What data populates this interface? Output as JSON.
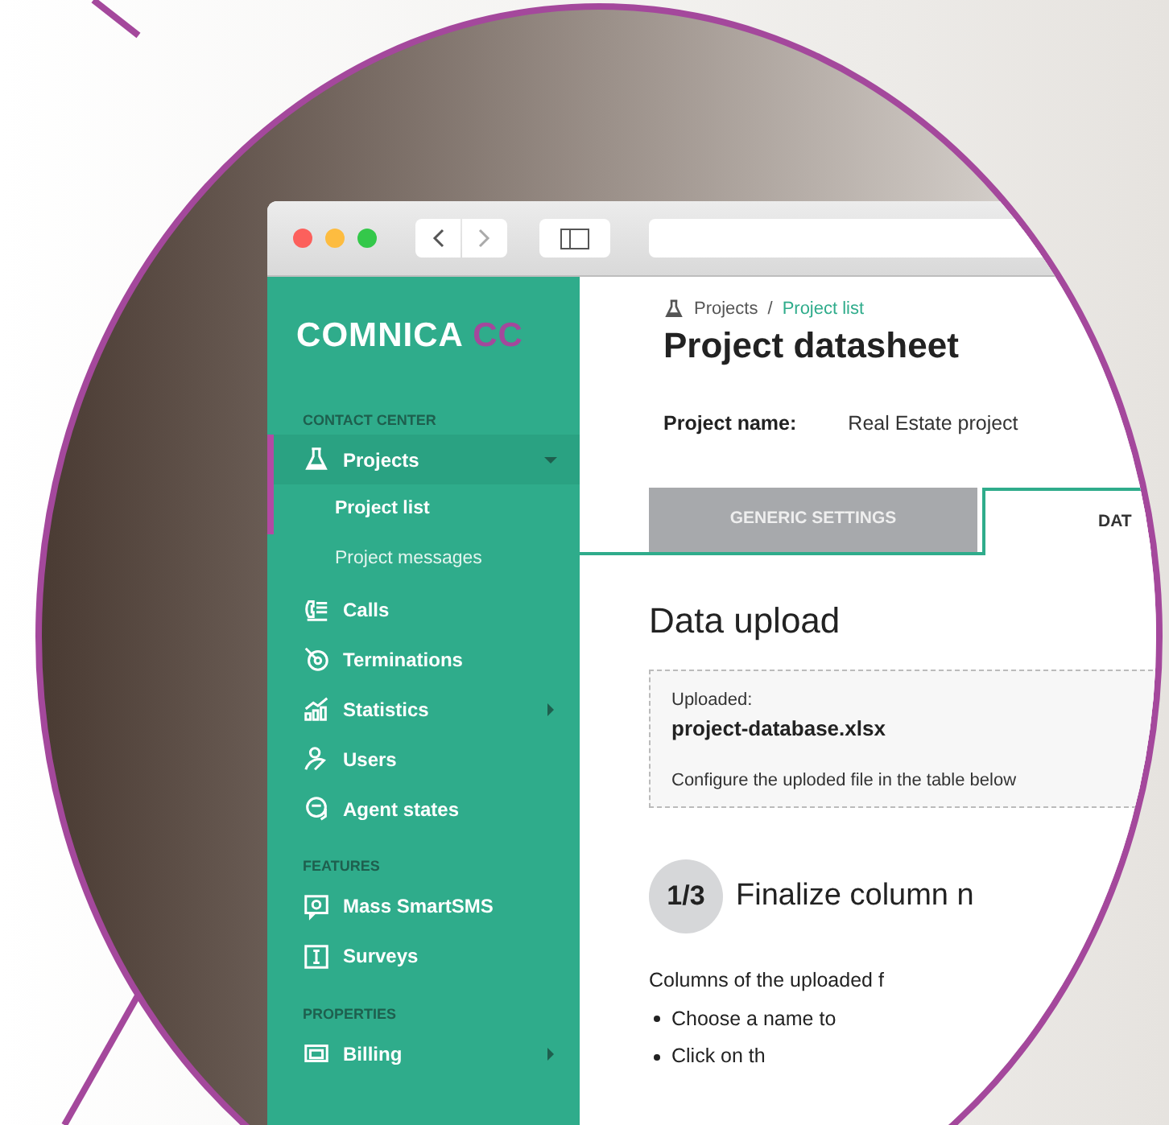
{
  "sidebar": {
    "logo": {
      "name": "COMNICA",
      "accent": "CC"
    },
    "sections": [
      {
        "heading": "CONTACT CENTER",
        "items": [
          {
            "label": "Projects",
            "selected": true,
            "has_submenu": true,
            "expanded": true,
            "children": [
              {
                "label": "Project list",
                "selected": true
              },
              {
                "label": "Project messages",
                "selected": false
              }
            ]
          },
          {
            "label": "Calls",
            "selected": false,
            "has_submenu": false
          },
          {
            "label": "Terminations",
            "selected": false,
            "has_submenu": false
          },
          {
            "label": "Statistics",
            "selected": false,
            "has_submenu": true,
            "expanded": false
          },
          {
            "label": "Users",
            "selected": false,
            "has_submenu": false
          },
          {
            "label": "Agent states",
            "selected": false,
            "has_submenu": false
          }
        ]
      },
      {
        "heading": "FEATURES",
        "items": [
          {
            "label": "Mass SmartSMS",
            "selected": false,
            "has_submenu": false
          },
          {
            "label": "Surveys",
            "selected": false,
            "has_submenu": false
          }
        ]
      },
      {
        "heading": "PROPERTIES",
        "items": [
          {
            "label": "Billing",
            "selected": false,
            "has_submenu": true,
            "expanded": false
          }
        ]
      }
    ]
  },
  "breadcrumb_separator": "/",
  "breadcrumb": [
    {
      "label": "Projects",
      "current": false
    },
    {
      "label": "Project list",
      "current": true
    }
  ],
  "title": "Project datasheet",
  "project_field": {
    "label": "Project name:",
    "value": "Real Estate project"
  },
  "tabs": [
    {
      "label": "GENERIC SETTINGS",
      "selected": false
    },
    {
      "label": "DAT",
      "selected": true
    }
  ],
  "section_title": "Data upload",
  "upload_box": {
    "label": "Uploaded:",
    "filename": "project-database.xlsx",
    "hint": "Configure the uploded file in the table below"
  },
  "step": {
    "number": "1/3",
    "title": "Finalize column n"
  },
  "intro": "Columns of the uploaded f",
  "bullets": [
    "Choose a name to",
    "Click on th"
  ]
}
